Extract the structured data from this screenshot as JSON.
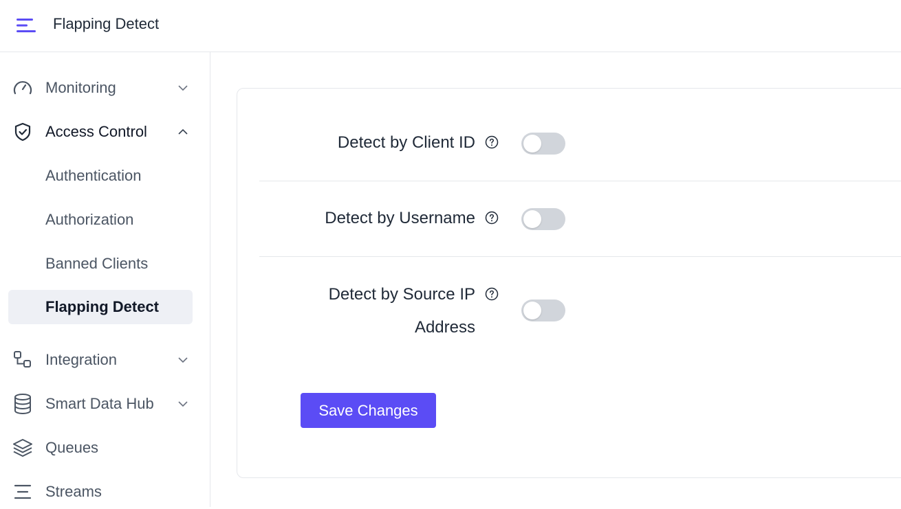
{
  "header": {
    "title": "Flapping Detect",
    "menu_icon": "menu-icon",
    "accent": "#5b4cf5"
  },
  "sidebar": {
    "items": [
      {
        "label": "Monitoring",
        "icon": "gauge-icon",
        "expanded": false
      },
      {
        "label": "Access Control",
        "icon": "shield-check-icon",
        "expanded": true,
        "children": [
          "Authentication",
          "Authorization",
          "Banned Clients",
          "Flapping Detect"
        ]
      },
      {
        "label": "Integration",
        "icon": "integration-icon",
        "expanded": false
      },
      {
        "label": "Smart Data Hub",
        "icon": "database-icon",
        "expanded": false
      },
      {
        "label": "Queues",
        "icon": "layers-icon"
      },
      {
        "label": "Streams",
        "icon": "streams-icon"
      }
    ],
    "active": "Flapping Detect"
  },
  "form": {
    "fields": [
      {
        "label": "Detect by Client ID",
        "enabled": false
      },
      {
        "label": "Detect by Username",
        "enabled": false
      },
      {
        "label_line1": "Detect by Source IP",
        "label_line2": "Address",
        "enabled": false
      }
    ],
    "save_label": "Save Changes"
  }
}
